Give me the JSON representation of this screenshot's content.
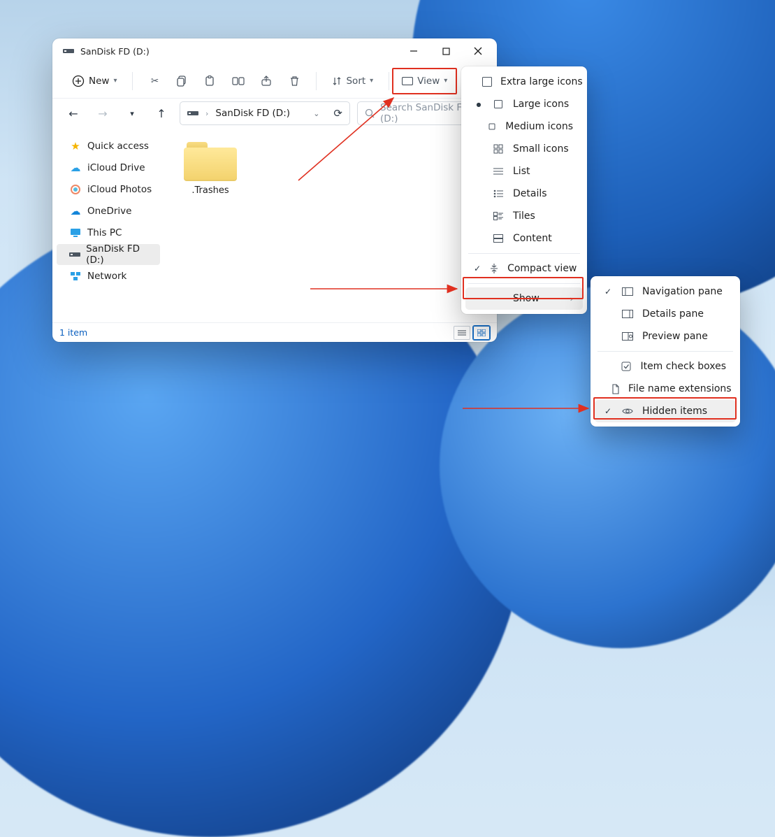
{
  "window": {
    "title": "SanDisk FD (D:)",
    "toolbar": {
      "new": "New",
      "sort": "Sort",
      "view": "View"
    },
    "address": {
      "path": "SanDisk FD (D:)"
    },
    "search": {
      "placeholder": "Search SanDisk FD (D:)"
    },
    "sidebar": {
      "items": [
        {
          "label": "Quick access"
        },
        {
          "label": "iCloud Drive"
        },
        {
          "label": "iCloud Photos"
        },
        {
          "label": "OneDrive"
        },
        {
          "label": "This PC"
        },
        {
          "label": "SanDisk FD (D:)"
        },
        {
          "label": "Network"
        }
      ]
    },
    "content": {
      "items": [
        {
          "label": ".Trashes"
        }
      ]
    },
    "status": {
      "text": "1 item"
    }
  },
  "view_menu": {
    "items": [
      {
        "label": "Extra large icons",
        "bullet": false
      },
      {
        "label": "Large icons",
        "bullet": true
      },
      {
        "label": "Medium icons",
        "bullet": false
      },
      {
        "label": "Small icons",
        "bullet": false
      },
      {
        "label": "List",
        "bullet": false
      },
      {
        "label": "Details",
        "bullet": false
      },
      {
        "label": "Tiles",
        "bullet": false
      },
      {
        "label": "Content",
        "bullet": false
      }
    ],
    "compact": {
      "label": "Compact view",
      "checked": true
    },
    "show": {
      "label": "Show"
    }
  },
  "show_menu": {
    "items": [
      {
        "label": "Navigation pane",
        "checked": true
      },
      {
        "label": "Details pane",
        "checked": false
      },
      {
        "label": "Preview pane",
        "checked": false
      },
      {
        "label": "Item check boxes",
        "checked": false
      },
      {
        "label": "File name extensions",
        "checked": false
      },
      {
        "label": "Hidden items",
        "checked": true
      }
    ]
  }
}
